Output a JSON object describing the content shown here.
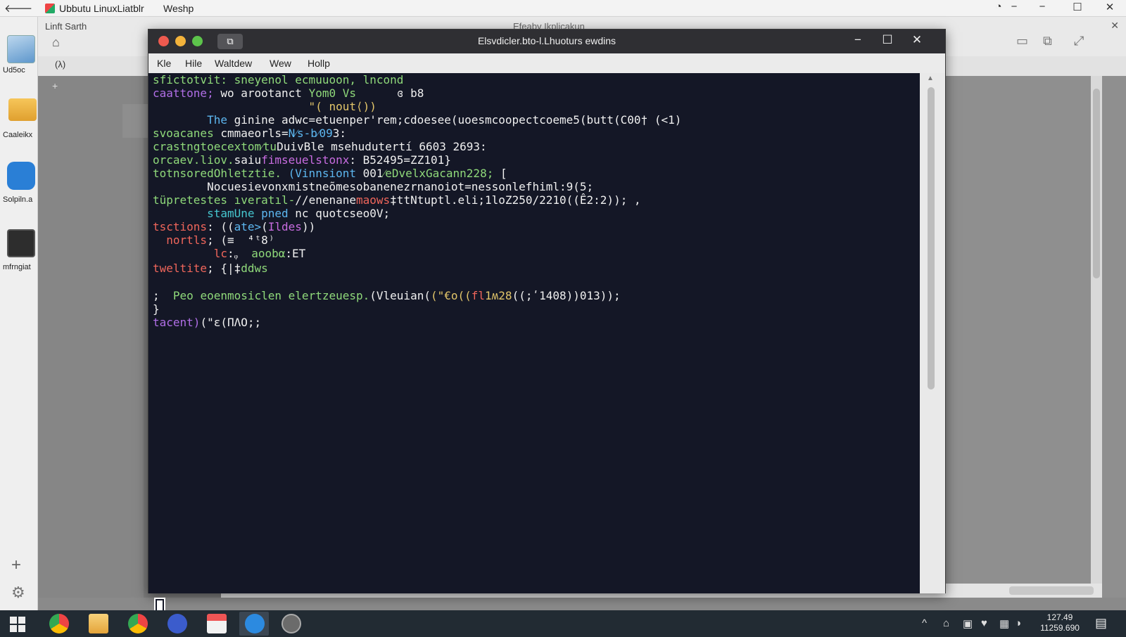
{
  "host": {
    "back_glyph": "🡐",
    "title": "Ubbutu LinuxLiatblr",
    "menu": "Weshp",
    "controls": [
      "◔",
      "−",
      "−",
      "☐",
      "✕"
    ]
  },
  "desktop": {
    "icons": [
      {
        "label": "Ud5oc",
        "icon": "image-file-icon"
      },
      {
        "label": "Caaleikx",
        "icon": "folder-icon"
      },
      {
        "label": "Solpiln.a",
        "icon": "chart-app-icon"
      },
      {
        "label": "mfrngiat",
        "icon": "monitor-icon"
      }
    ],
    "add_glyph": "+",
    "settings_glyph": "⚙"
  },
  "bg_window": {
    "title": "Linft Sarth",
    "center_title": "Efeaby Ikplicakun",
    "path": "(λ)",
    "side_glyph": "+",
    "home_glyph": "⌂",
    "close_glyph": "✕",
    "tool_glyphs": [
      "▭",
      "⧉",
      "⤢"
    ]
  },
  "terminal": {
    "title": "Elsvdicler.bto-l.Lhuoturs ewdins",
    "new_tab_glyph": "⧉",
    "menu": [
      "Kle",
      "Hile",
      "Waltdew",
      "Wew",
      "Hollp"
    ],
    "controls": [
      "−",
      "☐",
      "✕"
    ],
    "lines": [
      [
        {
          "t": "sfictotvit: ",
          "c": "green"
        },
        {
          "t": "sneyenol ecmuuoon, lncond",
          "c": "green"
        }
      ],
      [
        {
          "t": "caattone; ",
          "c": "purple"
        },
        {
          "t": "wo arootanct ",
          "c": "white"
        },
        {
          "t": "Yom0 Vs      ",
          "c": "green"
        },
        {
          "t": "ɞ b8",
          "c": "white"
        }
      ],
      [
        {
          "t": "                       \"( nout⟨))",
          "c": "yellow"
        }
      ],
      [
        {
          "t": "        The ",
          "c": "blue"
        },
        {
          "t": "ginine adwc=etuenper'rem;cdoesee(uoesmcoopectcoeme5(butt(C00† (<1)",
          "c": "white"
        }
      ],
      [
        {
          "t": "svoacanes ",
          "c": "green"
        },
        {
          "t": "cmmaeorls=",
          "c": "white"
        },
        {
          "t": "N⁄s-b⁄09",
          "c": "blue"
        },
        {
          "t": "3:",
          "c": "white"
        }
      ],
      [
        {
          "t": "crastngtoecextom⁄tu",
          "c": "green"
        },
        {
          "t": "DuivBle ",
          "c": "white"
        },
        {
          "t": "msehudutertí 6603 2693:",
          "c": "white"
        }
      ],
      [
        {
          "t": "orcaev.liov.",
          "c": "green"
        },
        {
          "t": "saiu",
          "c": "white"
        },
        {
          "t": "fimseuelstonx",
          "c": "magenta"
        },
        {
          "t": ": B52495=ZZ101}",
          "c": "white"
        }
      ],
      [
        {
          "t": "totnsoredOhletztie. ",
          "c": "green"
        },
        {
          "t": "(Vinnsiont ",
          "c": "blue"
        },
        {
          "t": "001",
          "c": "white"
        },
        {
          "t": "⁄eDvelx",
          "c": "green"
        },
        {
          "t": "Gacann228; ",
          "c": "green"
        },
        {
          "t": "[",
          "c": "white"
        }
      ],
      [
        {
          "t": "        Nocuesievonxmistneõmesobanenezrnanoiot=nessonlefhiml:9(5;",
          "c": "white"
        }
      ],
      [
        {
          "t": "tüpretestes ",
          "c": "green"
        },
        {
          "t": "ıveratıl-",
          "c": "green"
        },
        {
          "t": "//enenane",
          "c": "white"
        },
        {
          "t": "maows",
          "c": "red"
        },
        {
          "t": "‡ttNtuptl.",
          "c": "white"
        },
        {
          "t": "eli;1loZ250/2210(",
          "c": "white"
        },
        {
          "t": "(Ê2:2)); ,",
          "c": "white"
        }
      ],
      [
        {
          "t": "        stamUne ",
          "c": "cyan"
        },
        {
          "t": "pned ",
          "c": "blue"
        },
        {
          "t": "nc quotcseo0V;",
          "c": "white"
        }
      ],
      [
        {
          "t": "tsctions",
          "c": "red"
        },
        {
          "t": ": ((",
          "c": "white"
        },
        {
          "t": "ate>",
          "c": "blue"
        },
        {
          "t": "(",
          "c": "white"
        },
        {
          "t": "Ildes",
          "c": "magenta"
        },
        {
          "t": "))",
          "c": "white"
        }
      ],
      [
        {
          "t": "  nortls",
          "c": "red"
        },
        {
          "t": "; (≡  ⁴ᵗ8⁾",
          "c": "white"
        }
      ],
      [
        {
          "t": "         ",
          "c": "white"
        },
        {
          "t": "lc",
          "c": "red"
        },
        {
          "t": ":ᵩ  ",
          "c": "white"
        },
        {
          "t": "aoobα",
          "c": "green"
        },
        {
          "t": ":ET",
          "c": "white"
        }
      ],
      [
        {
          "t": "tweltite",
          "c": "red"
        },
        {
          "t": "; ",
          "c": "white"
        },
        {
          "t": "{|‡",
          "c": "white"
        },
        {
          "t": "ddws",
          "c": "green"
        }
      ],
      [
        {
          "t": ";  ",
          "c": "white"
        },
        {
          "t": "Peo eoenmosiclen elertzeuesp.",
          "c": "green"
        },
        {
          "t": "(Vleuian(",
          "c": "white"
        },
        {
          "t": "(\"€o((",
          "c": "yellow"
        },
        {
          "t": "fl",
          "c": "red"
        },
        {
          "t": "1ʍ28",
          "c": "yellow"
        },
        {
          "t": "((;ʹ1408))013));",
          "c": "white"
        }
      ],
      [
        {
          "t": "}",
          "c": "white"
        }
      ],
      [
        {
          "t": "tacent)",
          "c": "purple"
        },
        {
          "t": "(\"ɛ(ΠΛΟ;;",
          "c": "white"
        }
      ]
    ]
  },
  "taskbar": {
    "apps": [
      "chrome-icon",
      "file-explorer-icon",
      "chrome-icon",
      "u-app-icon",
      "calendar-app-icon",
      "edge-icon",
      "steam-icon"
    ],
    "tray": [
      "^",
      "⌂",
      "▣",
      "♥",
      "▦",
      "◑"
    ],
    "clock_time": "127.49",
    "clock_date": "11259.690",
    "notif_glyph": "▤"
  },
  "colors": {
    "terminal_bg": "#141726",
    "taskbar_bg": "#222b33",
    "green": "#8fd97a",
    "purple": "#b06ee6",
    "blue": "#5db7f0",
    "red": "#f0665b"
  }
}
